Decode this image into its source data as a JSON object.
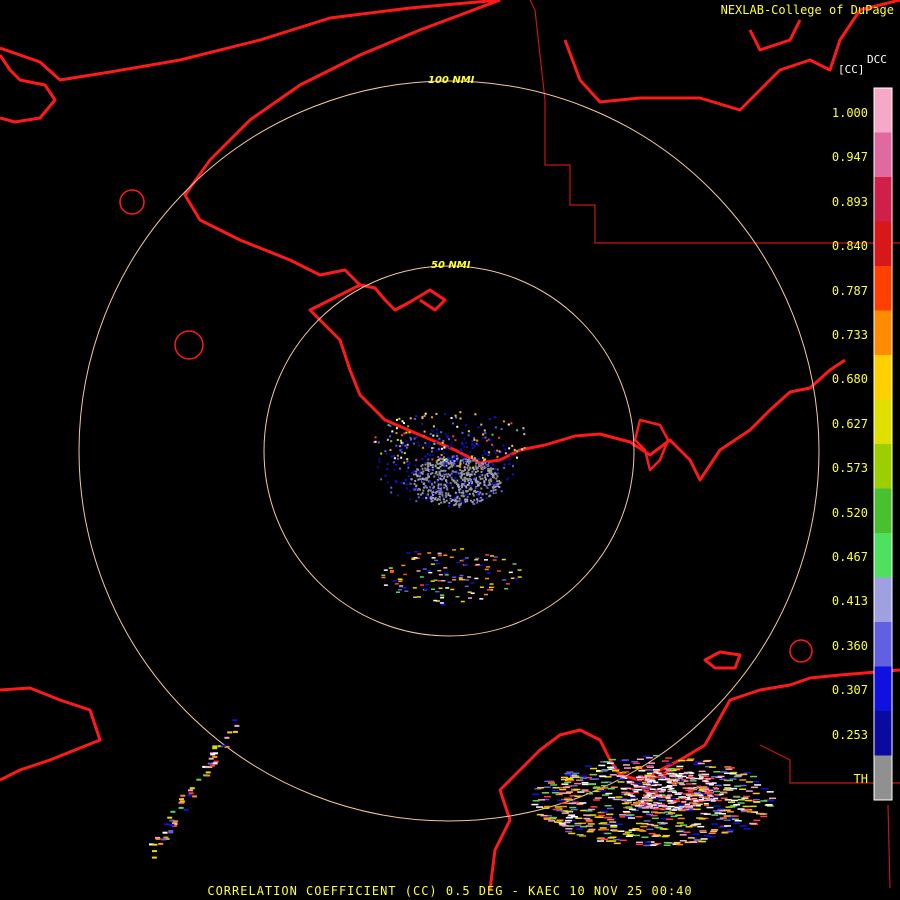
{
  "credit": "NEXLAB-College of DuPage",
  "product_code": "DCC",
  "unit": "[CC]",
  "footer": "CORRELATION COEFFICIENT (CC) 0.5 DEG - KAEC 10 NOV 25 00:40",
  "range_rings": [
    {
      "label": "50 NMI"
    },
    {
      "label": "100 NMI"
    }
  ],
  "legend": {
    "labels": [
      "1.000",
      "0.947",
      "0.893",
      "0.840",
      "0.787",
      "0.733",
      "0.680",
      "0.627",
      "0.573",
      "0.520",
      "0.467",
      "0.413",
      "0.360",
      "0.307",
      "0.253",
      "TH"
    ],
    "colors": [
      "#f7a8c8",
      "#e06aa0",
      "#d0204a",
      "#d81818",
      "#ff4000",
      "#ff8c00",
      "#ffd000",
      "#e0e000",
      "#9ccf00",
      "#48c030",
      "#50e060",
      "#a0a0e0",
      "#6060e0",
      "#1010e0",
      "#0a0aa0",
      "#909090"
    ],
    "colors_note": "scale from pink (high CC) to gray (low CC)"
  },
  "colors": {
    "coast": "#ff1a1a",
    "border": "#c81414",
    "ring": "#f5c8a0",
    "text": "#ffff33"
  }
}
